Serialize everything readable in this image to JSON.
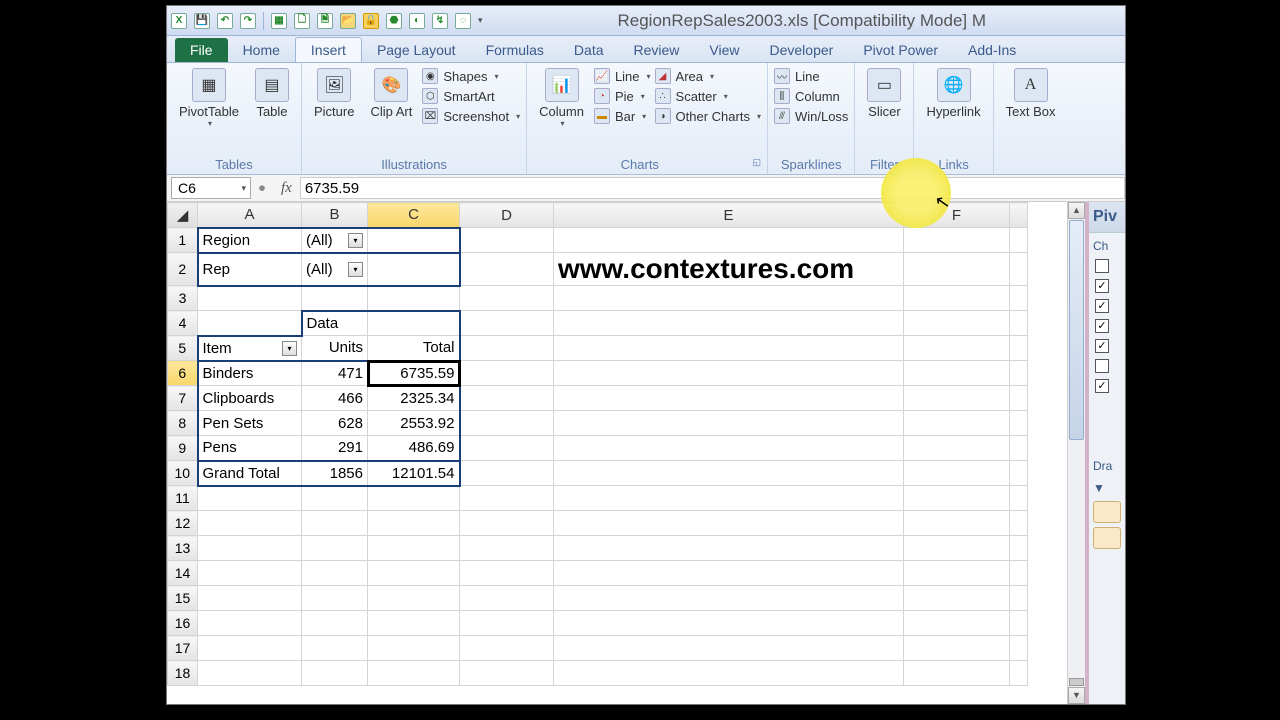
{
  "title": "RegionRepSales2003.xls  [Compatibility Mode] M",
  "tabs": [
    "File",
    "Home",
    "Insert",
    "Page Layout",
    "Formulas",
    "Data",
    "Review",
    "View",
    "Developer",
    "Pivot Power",
    "Add-Ins"
  ],
  "ribbon": {
    "tables": {
      "label": "Tables",
      "pivot": "PivotTable",
      "table": "Table"
    },
    "illus": {
      "label": "Illustrations",
      "picture": "Picture",
      "clipart": "Clip Art",
      "shapes": "Shapes",
      "smartart": "SmartArt",
      "screenshot": "Screenshot"
    },
    "charts": {
      "label": "Charts",
      "column": "Column",
      "line": "Line",
      "pie": "Pie",
      "bar": "Bar",
      "area": "Area",
      "scatter": "Scatter",
      "other": "Other Charts"
    },
    "spark": {
      "label": "Sparklines",
      "line": "Line",
      "column": "Column",
      "winloss": "Win/Loss"
    },
    "filter": {
      "label": "Filter",
      "slicer": "Slicer"
    },
    "links": {
      "label": "Links",
      "hyperlink": "Hyperlink"
    },
    "text": {
      "label": "",
      "textbox": "Text Box"
    }
  },
  "namebox": "C6",
  "formula": "6735.59",
  "cols": [
    "A",
    "B",
    "C",
    "D",
    "E",
    "F"
  ],
  "pivot": {
    "region_label": "Region",
    "region_val": "(All)",
    "rep_label": "Rep",
    "rep_val": "(All)",
    "data_label": "Data",
    "item_label": "Item",
    "units_label": "Units",
    "total_label": "Total",
    "rows": [
      {
        "item": "Binders",
        "units": "471",
        "total": "6735.59"
      },
      {
        "item": "Clipboards",
        "units": "466",
        "total": "2325.34"
      },
      {
        "item": "Pen Sets",
        "units": "628",
        "total": "2553.92"
      },
      {
        "item": "Pens",
        "units": "291",
        "total": "486.69"
      }
    ],
    "grand": "Grand Total",
    "grand_units": "1856",
    "grand_total": "12101.54"
  },
  "watermark": "www.contextures.com",
  "pane": {
    "title": "Piv",
    "choose": "Ch",
    "drag": "Dra"
  },
  "checks": [
    false,
    true,
    true,
    true,
    true,
    false,
    true
  ]
}
